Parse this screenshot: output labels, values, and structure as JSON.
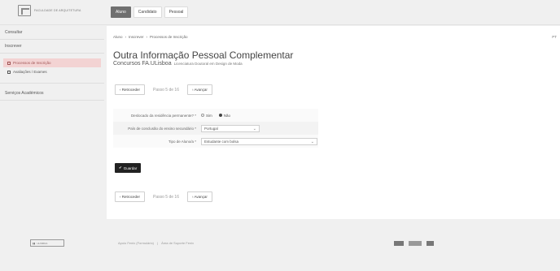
{
  "header": {
    "logo_text": "FACULDADE DE ARQUITETURA",
    "tabs": [
      {
        "label": "Aluno",
        "active": true
      },
      {
        "label": "Candidato",
        "active": false
      },
      {
        "label": "Pessoal",
        "active": false
      }
    ]
  },
  "sidebar": {
    "links_top": [
      "Consultar",
      "Inscrever"
    ],
    "subitems": [
      {
        "label": "Processos de Inscrição",
        "active": true
      },
      {
        "label": "Avaliações / Exames",
        "active": false
      }
    ],
    "links_bottom": [
      "Serviços Académicos"
    ]
  },
  "main": {
    "breadcrumb": [
      "Aluno",
      "Inscrever",
      "Processos de Inscrição"
    ],
    "language": "PT",
    "title": "Outra Informação Pessoal Complementar",
    "subtitle": "Concursos FA.ULisboa",
    "subtitle_small": "Licenciatura Doutoral em Design de Moda",
    "nav": {
      "back_label": "Retroceder",
      "step_label": "Passo 5 de 16",
      "next_label": "Avançar"
    },
    "form": {
      "residencia_label": "Deslocado da residência permanente? *",
      "residencia_options": [
        {
          "label": "Sim",
          "checked": false
        },
        {
          "label": "Não",
          "checked": true
        }
      ],
      "pais_label": "País de conclusão do ensino secundário *",
      "pais_value": "Portugal",
      "tipo_label": "Tipo de Aluno/a *",
      "tipo_value": "Estudante com bolsa"
    },
    "save_label": "Guardar"
  },
  "footer": {
    "logo_text": "ULISBOA",
    "links": [
      "Apoio Fenix (Formulário)",
      "|",
      "Área de Suporte Fenix"
    ]
  }
}
